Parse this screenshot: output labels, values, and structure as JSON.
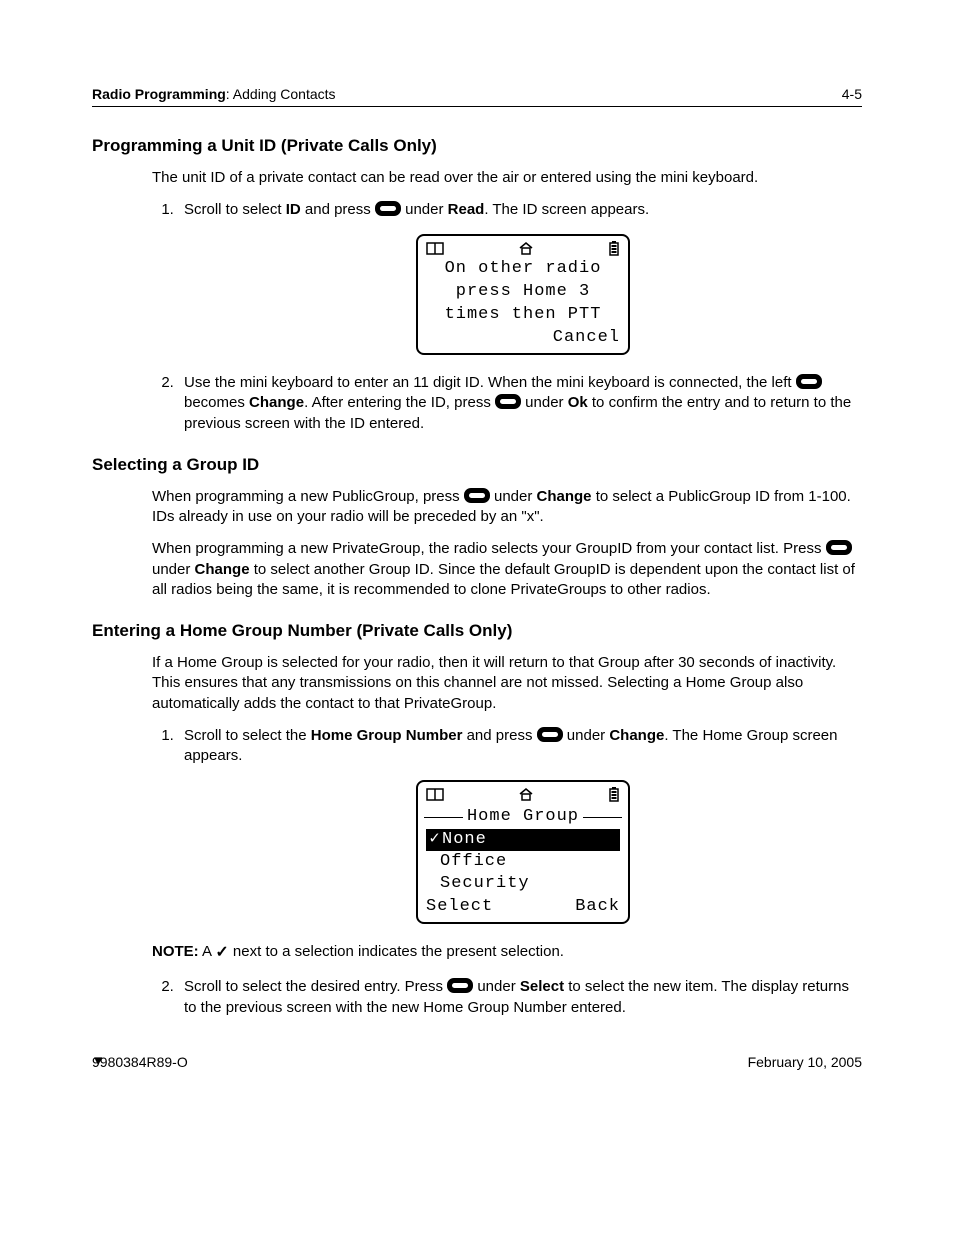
{
  "header": {
    "section_bold": "Radio Programming",
    "section_rest": ": Adding Contacts",
    "page_num": "4-5"
  },
  "sections": {
    "unit_id": {
      "title": "Programming a Unit ID (Private Calls Only)",
      "intro": "The unit ID of a private contact can be read over the air or entered using the mini keyboard.",
      "step1_a": "Scroll to select ",
      "step1_b_bold": "ID",
      "step1_c": " and press ",
      "step1_d": " under ",
      "step1_e_bold": "Read",
      "step1_f": ". The ID screen appears.",
      "step2_a": "Use the mini keyboard to enter an 11 digit ID. When the mini keyboard is connected, the left ",
      "step2_b": " becomes ",
      "step2_c_bold": "Change",
      "step2_d": ". After entering the ID, press ",
      "step2_e": " under ",
      "step2_f_bold": "Ok",
      "step2_g": " to confirm the entry and to return to the previous screen with the ID entered."
    },
    "group_id": {
      "title": "Selecting a Group ID",
      "p1_a": "When programming a new PublicGroup, press ",
      "p1_b": " under ",
      "p1_c_bold": "Change",
      "p1_d": " to select a PublicGroup ID from 1-100. IDs already in use on your radio will be preceded by an \"x\".",
      "p2_a": "When programming a new PrivateGroup, the radio selects your GroupID from your contact list. Press ",
      "p2_b": " under ",
      "p2_c_bold": "Change",
      "p2_d": " to select another Group ID. Since the default GroupID is dependent upon the contact list of all radios being the same, it is recommended to clone PrivateGroups to other radios."
    },
    "home_group": {
      "title": "Entering a Home Group Number (Private Calls Only)",
      "intro": "If a Home Group is selected for your radio, then it will return to that Group after 30 seconds of inactivity. This ensures that any transmissions on this channel are not missed. Selecting a Home Group also automatically adds the contact to that PrivateGroup.",
      "step1_a": "Scroll to select the ",
      "step1_b_bold": "Home Group Number",
      "step1_c": " and press ",
      "step1_d": " under ",
      "step1_e_bold": "Change",
      "step1_f": ". The Home Group screen appears.",
      "note_label": "NOTE:",
      "note_a": " A ",
      "note_b": " next to a selection indicates the present selection.",
      "step2_a": "Scroll to select the desired entry. Press ",
      "step2_b": " under ",
      "step2_c_bold": "Select",
      "step2_d": " to select the new item. The display returns to the previous screen with the new Home Group Number entered."
    }
  },
  "lcd1": {
    "line1": "On other radio",
    "line2": "press Home 3",
    "line3": "times then PTT",
    "soft_right": "Cancel"
  },
  "lcd2": {
    "title": "Home Group",
    "items": [
      "None",
      "Office",
      "Security"
    ],
    "selected_index": 0,
    "soft_left": "Select",
    "soft_right": "Back"
  },
  "footer": {
    "left": "9980384R89-O",
    "right": "February 10, 2005"
  }
}
